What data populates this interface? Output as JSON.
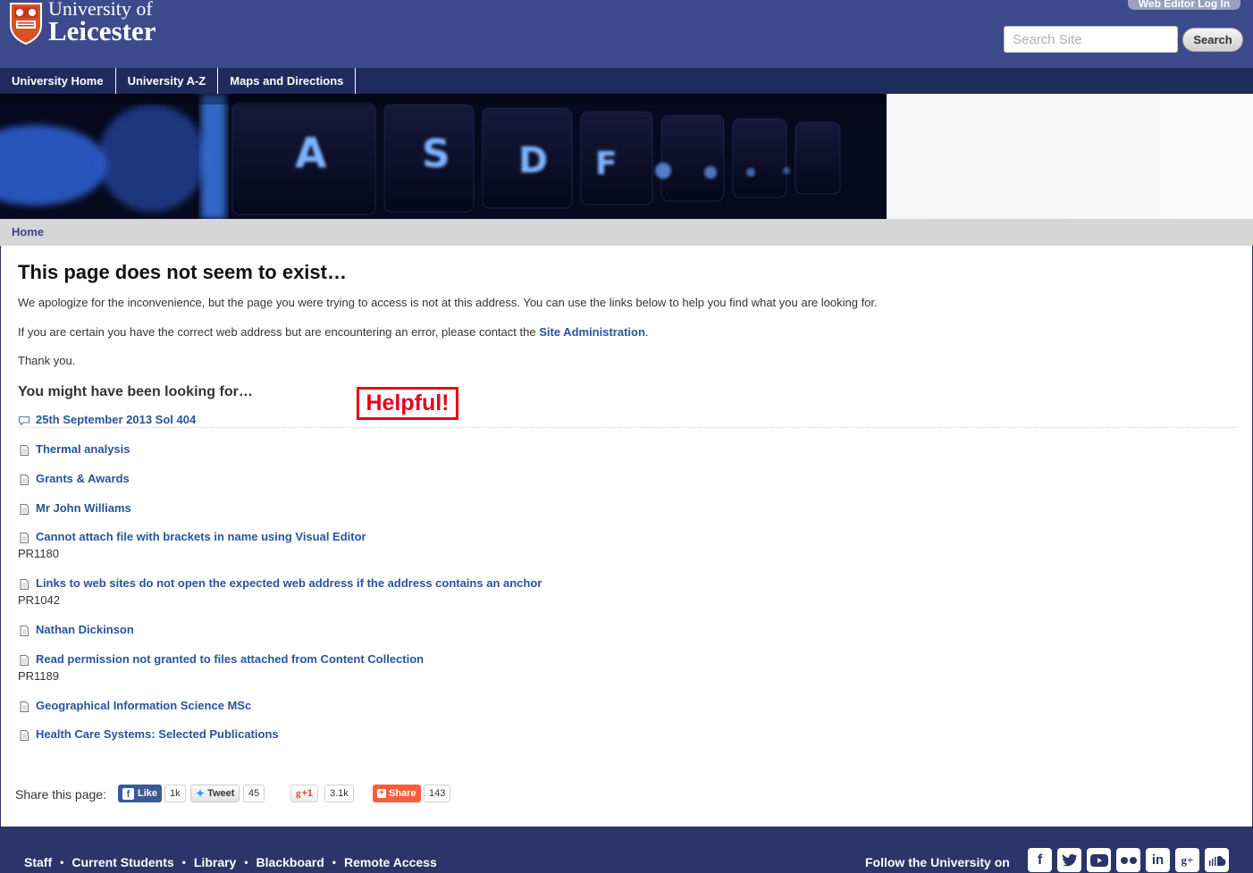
{
  "header": {
    "logo_line1": "University of",
    "logo_line2": "Leicester",
    "web_editor_login": "Web Editor Log In",
    "search_placeholder": "Search Site",
    "search_button": "Search"
  },
  "topnav": [
    "University Home",
    "University A-Z",
    "Maps and Directions"
  ],
  "breadcrumb": {
    "home": "Home"
  },
  "main": {
    "title": "This page does not seem to exist…",
    "para1": "We apologize for the inconvenience, but the page you were trying to access is not at this address. You can use the links below to help you find what you are looking for.",
    "para2_prefix": "If you are certain you have the correct web address but are encountering an error, please contact the",
    "para2_link": "Site Administration",
    "para2_suffix": ".",
    "para3": "Thank you.",
    "looking_heading": "You might have been looking for…",
    "helpful_badge": "Helpful!",
    "results": [
      {
        "title": "25th September 2013 Sol 404",
        "icon": "comment-icon"
      },
      {
        "title": "Thermal analysis",
        "icon": "page-icon"
      },
      {
        "title": "Grants & Awards",
        "icon": "page-icon"
      },
      {
        "title": "Mr John Williams",
        "icon": "page-icon"
      },
      {
        "title": "Cannot attach file with brackets in name using Visual Editor",
        "code": "PR1180",
        "icon": "page-icon"
      },
      {
        "title": "Links to web sites do not open the expected web address if the address contains an anchor",
        "code": "PR1042",
        "icon": "page-icon"
      },
      {
        "title": "Nathan Dickinson",
        "icon": "page-icon"
      },
      {
        "title": "Read permission not granted to files attached from Content Collection",
        "code": "PR1189",
        "icon": "page-icon"
      },
      {
        "title": "Geographical Information Science MSc",
        "icon": "page-icon"
      },
      {
        "title": "Health Care Systems: Selected Publications",
        "icon": "page-icon"
      }
    ]
  },
  "share": {
    "label": "Share this page:",
    "facebook": {
      "label": "Like",
      "count": "1k"
    },
    "twitter": {
      "label": "Tweet",
      "count": "45"
    },
    "gplus": {
      "label": "+1",
      "count": "3.1k"
    },
    "share": {
      "label": "Share",
      "count": "143"
    }
  },
  "footer": {
    "links": [
      "Staff",
      "Current Students",
      "Library",
      "Blackboard",
      "Remote Access"
    ],
    "follow_label": "Follow the University on",
    "social_icons": [
      "facebook-icon",
      "twitter-icon",
      "youtube-icon",
      "flickr-icon",
      "linkedin-icon",
      "google-plus-icon",
      "soundcloud-icon"
    ]
  },
  "colors": {
    "header_bg": "#3d4a8b",
    "nav_bg": "#1f2b5b",
    "link": "#27549b",
    "badge_red": "#e8001c",
    "footer_bg": "#2c3569"
  }
}
